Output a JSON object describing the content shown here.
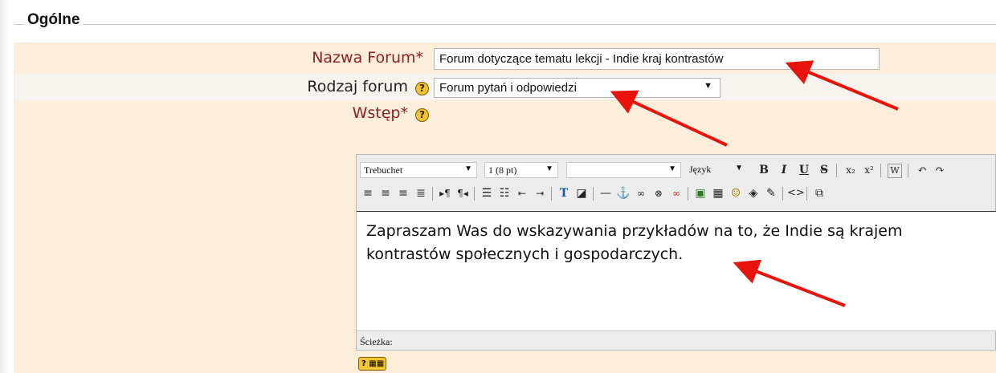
{
  "fieldset": {
    "legend": "Ogólne"
  },
  "fields": {
    "forum_name": {
      "label": "Nazwa Forum*",
      "value": "Forum dotyczące tematu lekcji - Indie kraj kontrastów"
    },
    "forum_type": {
      "label": "Rodzaj forum",
      "value": "Forum pytań i odpowiedzi"
    },
    "intro": {
      "label": "Wstęp*"
    }
  },
  "editor": {
    "font_family": "Trebuchet",
    "font_size": "1 (8 pt)",
    "format": "",
    "language": "Język",
    "content": "Zapraszam Was do wskazywania przykładów na to, że Indie są krajem kontrastów społecznych i gospodarczych.",
    "status_label": "Ścieżka:",
    "toolbar_row1": [
      "bold-icon",
      "italic-icon",
      "underline-icon",
      "strikethrough-icon",
      "subscript-icon",
      "superscript-icon",
      "word-paste-icon",
      "undo-icon",
      "redo-icon"
    ],
    "toolbar_row2": [
      "align-left-icon",
      "align-center-icon",
      "align-right-icon",
      "justify-icon",
      "ltr-icon",
      "rtl-icon",
      "ordered-list-icon",
      "unordered-list-icon",
      "outdent-icon",
      "indent-icon",
      "text-color-icon",
      "bg-color-icon",
      "horizontal-rule-icon",
      "anchor-icon",
      "link-icon",
      "unlink-icon",
      "nolink-icon",
      "image-icon",
      "table-icon",
      "smiley-icon",
      "special-char-icon",
      "spellcheck-icon",
      "html-source-icon",
      "fullscreen-icon"
    ]
  },
  "colors": {
    "required_label": "#8b2020",
    "band_orange": "#fdeedc",
    "band_light": "#f7f3ee",
    "arrow": "#e8140c",
    "help_icon": "#f3c331"
  }
}
